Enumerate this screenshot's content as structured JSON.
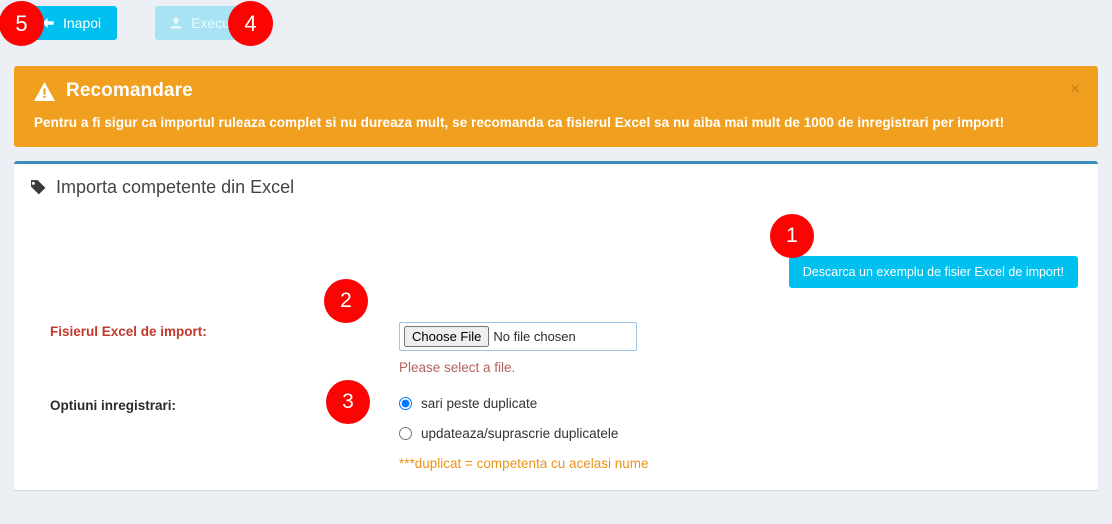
{
  "toolbar": {
    "back_label": "Inapoi",
    "back_icon": "arrow-left-icon",
    "execute_label": "Executa",
    "execute_icon": "upload-icon"
  },
  "alert": {
    "icon": "warning-triangle-icon",
    "title": "Recomandare",
    "message": "Pentru a fi sigur ca importul ruleaza complet si nu dureaza mult, se recomanda ca fisierul Excel sa nu aiba mai mult de 1000 de inregistrari per import!",
    "close_label": "×",
    "background_color": "#f0a01e"
  },
  "panel": {
    "icon": "tag-icon",
    "title": "Importa competente din Excel",
    "accent_color": "#3c8dbc",
    "download_button_label": "Descarca un exemplu de fisier Excel de import!",
    "file_row": {
      "label": "Fisierul Excel de import:",
      "label_color": "#c0392b",
      "button_text": "Choose File",
      "status_text": "No file chosen",
      "error_text": "Please select a file."
    },
    "options_row": {
      "label": "Optiuni inregistrari:",
      "option_1": "sari peste duplicate",
      "option_2": "updateaza/suprascrie duplicatele",
      "selected": "sari peste duplicate",
      "note": "***duplicat = competenta cu acelasi nume",
      "note_color": "#e8941a"
    }
  },
  "badges": {
    "one": "1",
    "two": "2",
    "three": "3",
    "four": "4",
    "five": "5",
    "color": "#fb0404"
  }
}
